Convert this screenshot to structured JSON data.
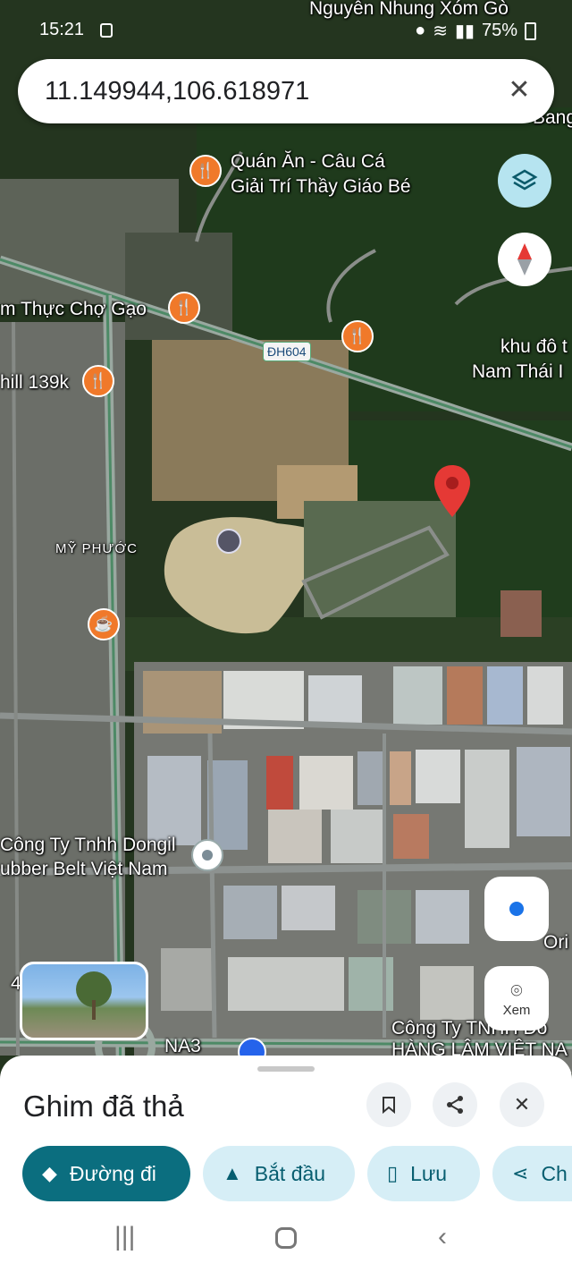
{
  "status_bar": {
    "time": "15:21",
    "battery": "75%"
  },
  "search": {
    "query": "11.149944,106.618971"
  },
  "map": {
    "road_badge": "ĐH604",
    "labels": {
      "quan_an_line1": "Quán Ăn - Câu Cá",
      "quan_an_line2": "Giải Trí Thầy Giáo Bé",
      "am_thuc": "m Thực Chợ Gạo",
      "chill": "hill 139k",
      "khu_do_thi_line1": "khu đô t",
      "khu_do_thi_line2": "Nam Thái I",
      "my_phuoc": "MỸ PHƯỚC",
      "dongil_line1": "Công Ty Tnhh Dongil",
      "dongil_line2": "ubber Belt Việt Nam",
      "top_cut": "Nguyễn Nhung Xóm Gò",
      "top_right_cut": "Bang",
      "na3": "NA3",
      "cong_ty_bottom_line1": "Công Ty TNHH Đồ",
      "cong_ty_bottom_line2": "HÀNG LÂM VIỆT NA",
      "ori": "Ori",
      "left_4": "4"
    },
    "lens_label": "Xem"
  },
  "sheet": {
    "title": "Ghim đã thả",
    "chips": {
      "directions": "Đường đi",
      "start": "Bắt đầu",
      "save": "Lưu",
      "share": "Ch"
    }
  },
  "colors": {
    "accent": "#0b6e7f",
    "pin": "#e53935",
    "poi": "#f0792a"
  }
}
